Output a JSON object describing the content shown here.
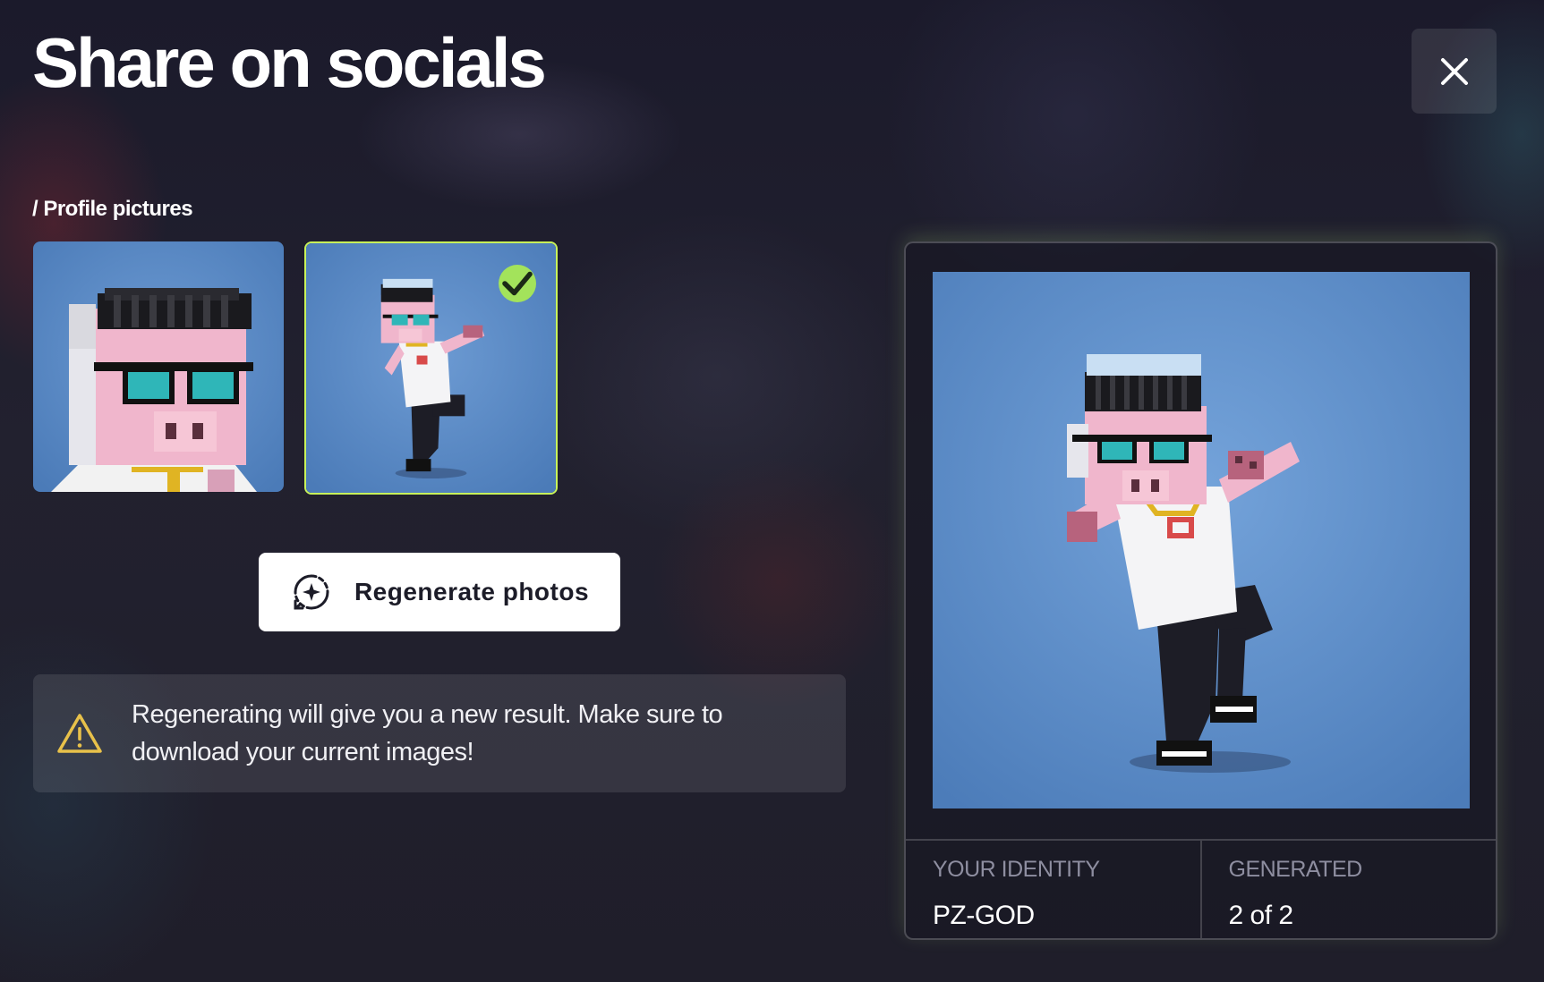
{
  "header": {
    "title": "Share on socials",
    "close_icon": "close-icon"
  },
  "gallery": {
    "section_label": "/ Profile pictures",
    "images": [
      {
        "name": "closeup-portrait",
        "selected": false
      },
      {
        "name": "dab-pose",
        "selected": true
      }
    ],
    "selected_badge_icon": "check-icon"
  },
  "actions": {
    "regenerate_label": "Regenerate photos",
    "regenerate_icon": "regenerate-sparkle-icon"
  },
  "warning": {
    "icon": "warning-triangle-icon",
    "text": "Regenerating will give you a new result. Make sure to download your current images!"
  },
  "preview": {
    "identity_label": "YOUR IDENTITY",
    "identity_value": "PZ-GOD",
    "generated_label": "GENERATED",
    "generated_value": "2 of 2"
  },
  "colors": {
    "accent": "#a3e35b",
    "background": "#1f1e2b",
    "image_bg": "#5f8fcb",
    "warning": "#e8c14a"
  }
}
